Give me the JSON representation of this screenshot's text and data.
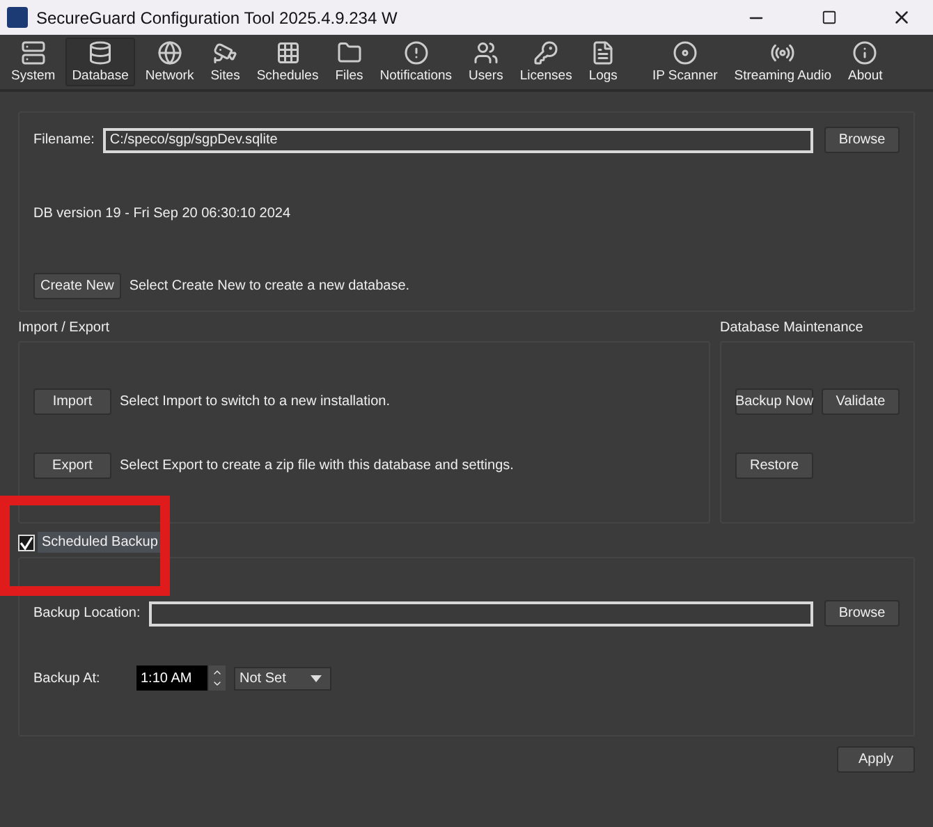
{
  "window": {
    "title": "SecureGuard Configuration Tool  2025.4.9.234 W"
  },
  "toolbar": [
    {
      "label": "System",
      "selected": false
    },
    {
      "label": "Database",
      "selected": true
    },
    {
      "label": "Network",
      "selected": false
    },
    {
      "label": "Sites",
      "selected": false
    },
    {
      "label": "Schedules",
      "selected": false
    },
    {
      "label": "Files",
      "selected": false
    },
    {
      "label": "Notifications",
      "selected": false
    },
    {
      "label": "Users",
      "selected": false
    },
    {
      "label": "Licenses",
      "selected": false
    },
    {
      "label": "Logs",
      "selected": false
    },
    {
      "label": "IP Scanner",
      "selected": false
    },
    {
      "label": "Streaming Audio",
      "selected": false
    },
    {
      "label": "About",
      "selected": false
    }
  ],
  "database": {
    "filename_label": "Filename:",
    "filename": "C:/speco/sgp/sgpDev.sqlite",
    "browse": "Browse",
    "version": "DB version 19 - Fri Sep 20 06:30:10 2024",
    "create_button": "Create New",
    "create_hint": "Select Create New to create a new database."
  },
  "import_export": {
    "title": "Import / Export",
    "rows": [
      {
        "button": "Import",
        "hint": "Select Import to switch to a new installation."
      },
      {
        "button": "Export",
        "hint": "Select Export to create a zip file with this database and settings."
      }
    ]
  },
  "maintenance": {
    "title": "Database Maintenance",
    "buttons": [
      "Backup Now",
      "Validate",
      "Restore"
    ]
  },
  "scheduled_backup": {
    "label": "Scheduled Backup",
    "checked": true,
    "highlighted": true,
    "location_label": "Backup Location:",
    "browse": "Browse",
    "at_label": "Backup At:",
    "time": "1:10 AM",
    "frequency": "Not Set"
  },
  "apply": "Apply"
}
